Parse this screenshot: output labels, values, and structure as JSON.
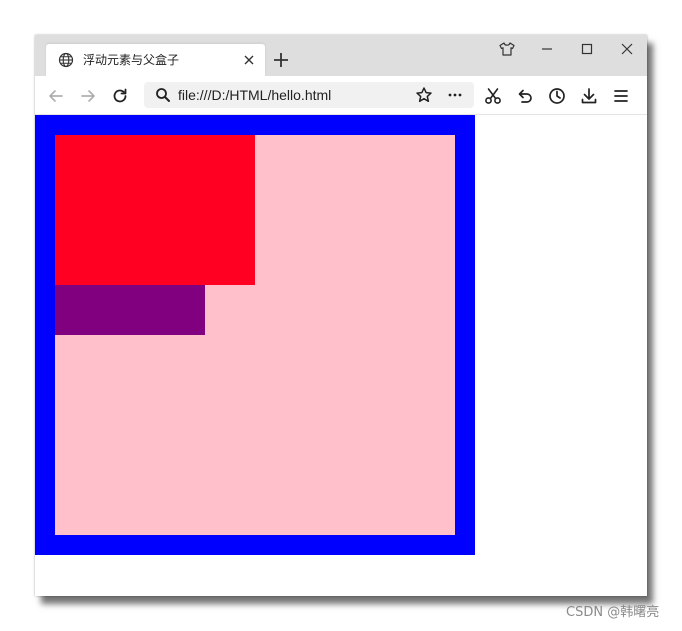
{
  "browser": {
    "tab": {
      "title": "浮动元素与父盒子",
      "icon": "globe-icon",
      "close_icon": "close-icon"
    },
    "new_tab_icon": "plus-icon",
    "window_controls": [
      "tshirt-icon",
      "minimize-icon",
      "maximize-icon",
      "close-icon"
    ],
    "nav": [
      "back-icon",
      "forward-icon",
      "reload-icon"
    ],
    "url": "file:///D:/HTML/hello.html",
    "url_icons": [
      "search-icon",
      "star-icon",
      "more-icon"
    ],
    "tools": [
      "scissors-icon",
      "undo-icon",
      "history-icon",
      "download-icon",
      "menu-icon"
    ]
  },
  "page": {
    "outer_box": {
      "border_color": "#0000ff",
      "background": "#ffc0cb"
    },
    "float_red": {
      "background": "#ff0022"
    },
    "float_purple": {
      "background": "#800080"
    }
  },
  "watermark": "CSDN @韩曙亮"
}
